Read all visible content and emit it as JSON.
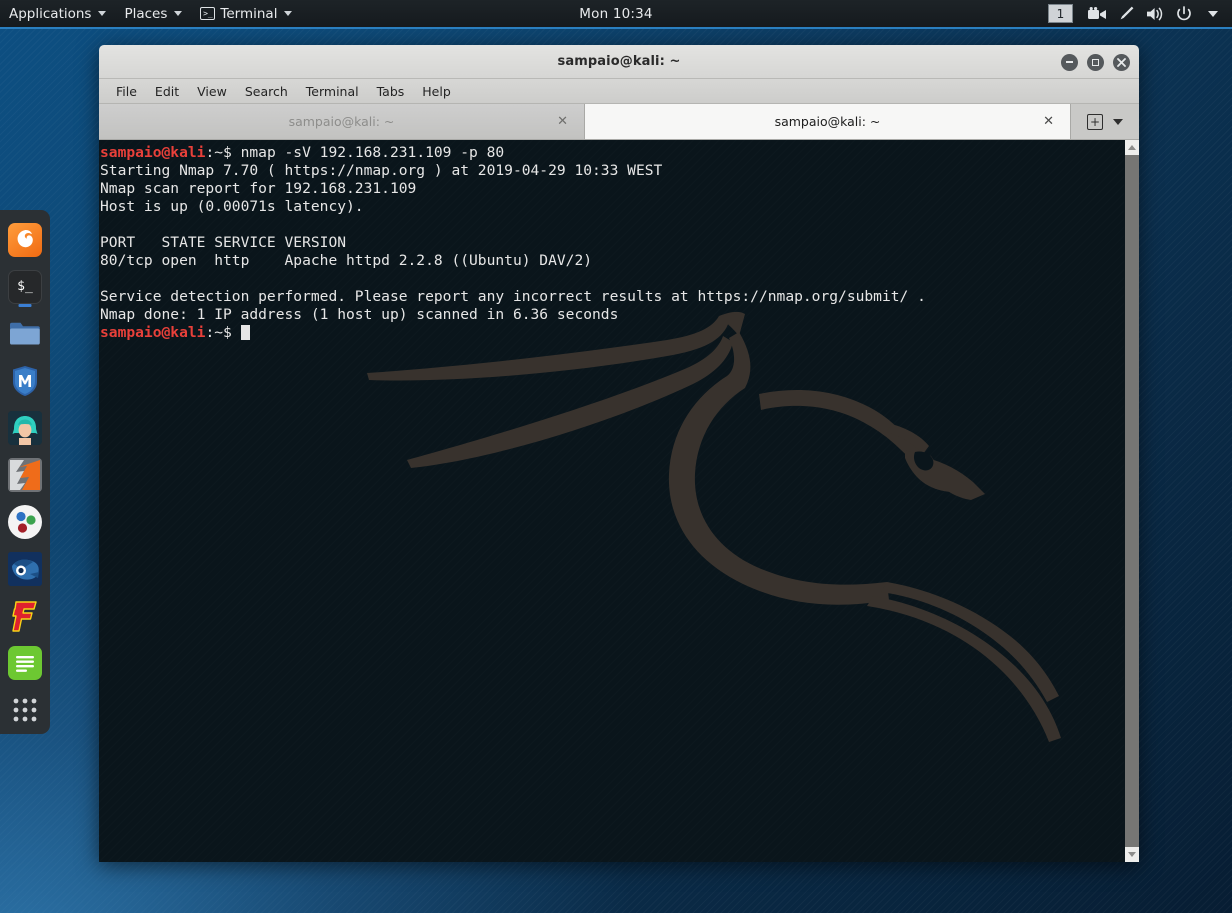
{
  "panel": {
    "applications_label": "Applications",
    "places_label": "Places",
    "terminal_label": "Terminal",
    "terminal_icon": "terminal-icon",
    "clock": "Mon 10:34",
    "workspace": "1",
    "tray": [
      {
        "name": "camera-icon",
        "glyph": "🎥"
      },
      {
        "name": "pen-icon",
        "glyph": "✒"
      },
      {
        "name": "volume-icon",
        "glyph": "🔊"
      },
      {
        "name": "power-icon",
        "glyph": "⏻"
      },
      {
        "name": "chevron-down-icon",
        "glyph": "▾"
      }
    ]
  },
  "dock": {
    "items": [
      {
        "name": "dock-item-firefox",
        "label": "Firefox",
        "running": false
      },
      {
        "name": "dock-item-terminal",
        "label": "Terminal",
        "running": true
      },
      {
        "name": "dock-item-files",
        "label": "Files",
        "running": false
      },
      {
        "name": "dock-item-metasploit",
        "label": "Metasploit Framework",
        "running": false
      },
      {
        "name": "dock-item-armitage",
        "label": "Armitage",
        "running": false
      },
      {
        "name": "dock-item-burpsuite",
        "label": "Burp Suite",
        "running": false
      },
      {
        "name": "dock-item-beef",
        "label": "BeEF",
        "running": false
      },
      {
        "name": "dock-item-wireshark",
        "label": "Wireshark",
        "running": false
      },
      {
        "name": "dock-item-faraday",
        "label": "Faraday",
        "running": false
      },
      {
        "name": "dock-item-texteditor",
        "label": "Text Editor",
        "running": false
      },
      {
        "name": "dock-item-show-applications",
        "label": "Show Applications",
        "running": false
      }
    ]
  },
  "window": {
    "title": "sampaio@kali: ~",
    "controls": {
      "minimize": "minimize-button",
      "maximize": "maximize-button",
      "close": "close-button"
    },
    "menu": [
      "File",
      "Edit",
      "View",
      "Search",
      "Terminal",
      "Tabs",
      "Help"
    ],
    "tabs": [
      {
        "label": "sampaio@kali: ~",
        "active": false,
        "close": "✕"
      },
      {
        "label": "sampaio@kali: ~",
        "active": true,
        "close": "✕"
      }
    ],
    "new_tab_glyph": "+",
    "tab_list_glyph": "▾"
  },
  "terminal": {
    "prompt_user": "sampaio@kali",
    "prompt_path": ":~$ ",
    "lines": [
      {
        "type": "prompt",
        "command": "nmap -sV 192.168.231.109 -p 80"
      },
      {
        "type": "out",
        "text": "Starting Nmap 7.70 ( https://nmap.org ) at 2019-04-29 10:33 WEST"
      },
      {
        "type": "out",
        "text": "Nmap scan report for 192.168.231.109"
      },
      {
        "type": "out",
        "text": "Host is up (0.00071s latency)."
      },
      {
        "type": "out",
        "text": ""
      },
      {
        "type": "out",
        "text": "PORT   STATE SERVICE VERSION"
      },
      {
        "type": "out",
        "text": "80/tcp open  http    Apache httpd 2.2.8 ((Ubuntu) DAV/2)"
      },
      {
        "type": "out",
        "text": ""
      },
      {
        "type": "out",
        "text": "Service detection performed. Please report any incorrect results at https://nmap.org/submit/ ."
      },
      {
        "type": "out",
        "text": "Nmap done: 1 IP address (1 host up) scanned in 6.36 seconds"
      },
      {
        "type": "prompt-cursor",
        "command": ""
      }
    ]
  },
  "colors": {
    "prompt_user": "#e8403a",
    "terminal_bg": "#0a151b",
    "terminal_fg": "#e6e6e6",
    "panel_bg": "#1a1f23",
    "accent_blue": "#2a7fc0",
    "dock_bg": "#2b3034"
  }
}
